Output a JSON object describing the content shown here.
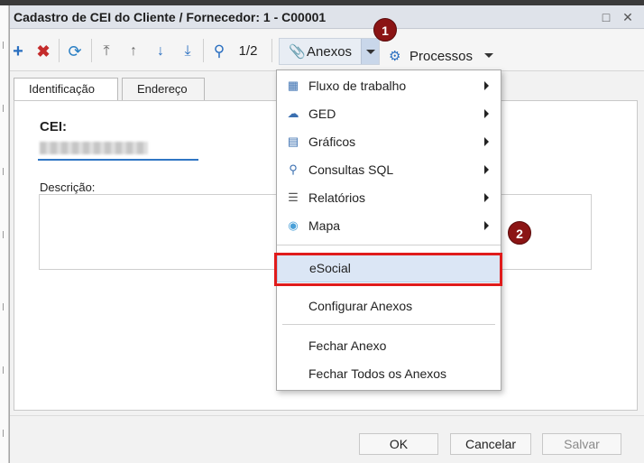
{
  "window": {
    "title": "Cadastro de CEI do Cliente / Fornecedor: 1 - C00001",
    "maximize_icon": "square-icon",
    "close_icon": "x-icon"
  },
  "toolbar": {
    "add_icon": "plus-icon",
    "delete_icon": "red-x-icon",
    "refresh_icon": "refresh-icon",
    "first_icon": "arrow-up-bar-icon",
    "prev_icon": "arrow-up-icon",
    "next_icon": "arrow-down-icon",
    "last_icon": "arrow-down-bar-icon",
    "search_icon": "magnifier-icon",
    "page_indicator": "1/2",
    "anexos_label": "Anexos",
    "processos_label": "Processos"
  },
  "tabs": [
    "Identificação",
    "Endereço"
  ],
  "form": {
    "cei_label": "CEI:",
    "descricao_label": "Descrição:"
  },
  "menu": {
    "items": [
      {
        "label": "Fluxo de trabalho",
        "icon": "workflow-icon",
        "submenu": true
      },
      {
        "label": "GED",
        "icon": "ged-icon",
        "submenu": true
      },
      {
        "label": "Gráficos",
        "icon": "chart-icon",
        "submenu": true
      },
      {
        "label": "Consultas SQL",
        "icon": "search-icon",
        "submenu": true
      },
      {
        "label": "Relatórios",
        "icon": "report-icon",
        "submenu": true
      },
      {
        "label": "Mapa",
        "icon": "map-pin-icon",
        "submenu": true
      },
      {
        "label": "eSocial",
        "icon": "",
        "submenu": false,
        "selected": true
      },
      {
        "label": "Configurar Anexos",
        "icon": "",
        "submenu": false
      },
      {
        "label": "Fechar Anexo",
        "icon": "",
        "submenu": false
      },
      {
        "label": "Fechar Todos os Anexos",
        "icon": "",
        "submenu": false
      }
    ]
  },
  "annotations": {
    "step1": "1",
    "step2": "2",
    "highlight_color": "#e01b1b",
    "badge_color": "#8b1414"
  },
  "footer": {
    "ok_label": "OK",
    "cancel_label": "Cancelar",
    "save_label": "Salvar"
  },
  "colors": {
    "accent": "#3076c4",
    "titlebar": "#dfe3ea"
  }
}
